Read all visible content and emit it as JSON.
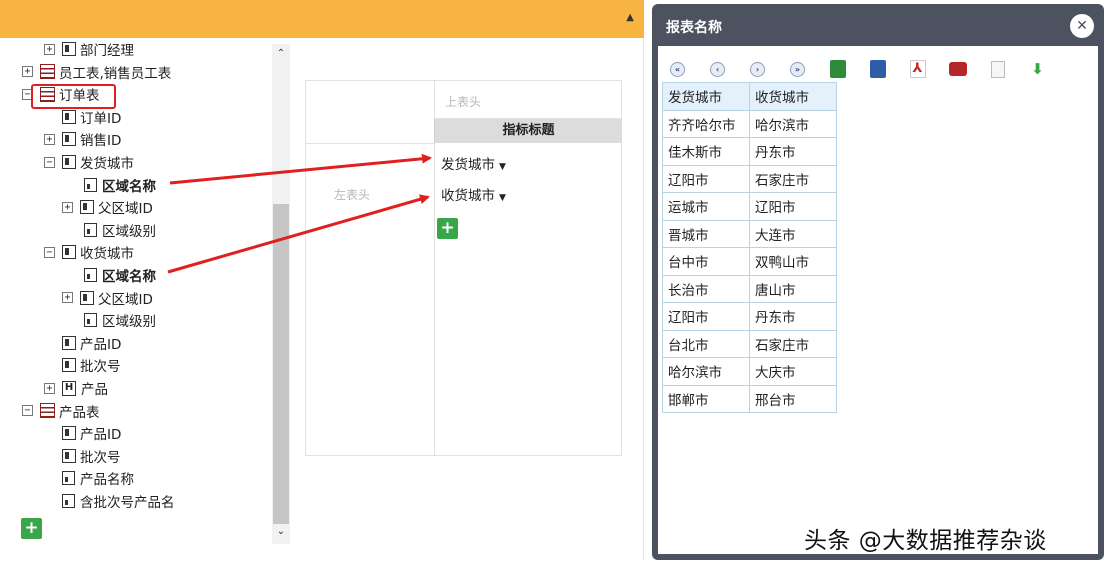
{
  "tree": {
    "items": [
      {
        "label": "部门经理",
        "indent": 1,
        "expander": "+",
        "icon": "field"
      },
      {
        "label": "员工表,销售员工表",
        "indent": 0,
        "expander": "+",
        "icon": "table"
      },
      {
        "label": "订单表",
        "indent": 0,
        "expander": "−",
        "icon": "table"
      },
      {
        "label": "订单ID",
        "indent": 2,
        "expander": "",
        "icon": "field"
      },
      {
        "label": "销售ID",
        "indent": 1,
        "expander": "+",
        "icon": "field"
      },
      {
        "label": "发货城市",
        "indent": 1,
        "expander": "−",
        "icon": "field"
      },
      {
        "label": "区域名称",
        "indent": 3,
        "expander": "",
        "icon": "leaf",
        "bold": true
      },
      {
        "label": "父区域ID",
        "indent": 2,
        "expander": "+",
        "icon": "field"
      },
      {
        "label": "区域级别",
        "indent": 3,
        "expander": "",
        "icon": "leaf"
      },
      {
        "label": "收货城市",
        "indent": 1,
        "expander": "−",
        "icon": "field"
      },
      {
        "label": "区域名称",
        "indent": 3,
        "expander": "",
        "icon": "leaf",
        "bold": true
      },
      {
        "label": "父区域ID",
        "indent": 2,
        "expander": "+",
        "icon": "field"
      },
      {
        "label": "区域级别",
        "indent": 3,
        "expander": "",
        "icon": "leaf"
      },
      {
        "label": "产品ID",
        "indent": 2,
        "expander": "",
        "icon": "field"
      },
      {
        "label": "批次号",
        "indent": 2,
        "expander": "",
        "icon": "field"
      },
      {
        "label": "产品",
        "indent": 1,
        "expander": "+",
        "icon": "H"
      },
      {
        "label": "产品表",
        "indent": 0,
        "expander": "−",
        "icon": "table"
      },
      {
        "label": "产品ID",
        "indent": 2,
        "expander": "",
        "icon": "field"
      },
      {
        "label": "批次号",
        "indent": 2,
        "expander": "",
        "icon": "field"
      },
      {
        "label": "产品名称",
        "indent": 2,
        "expander": "",
        "icon": "leaf"
      },
      {
        "label": "含批次号产品名",
        "indent": 2,
        "expander": "",
        "icon": "leaf"
      }
    ]
  },
  "designer": {
    "top_header": "上表头",
    "left_header": "左表头",
    "indicator_title": "指标标题",
    "fields": [
      "发货城市",
      "收货城市"
    ],
    "add_label": "+"
  },
  "tree_add_label": "+",
  "dialog": {
    "title": "报表名称",
    "close_label": "✕",
    "columns": [
      "发货城市",
      "收货城市"
    ],
    "rows": [
      [
        "齐齐哈尔市",
        "哈尔滨市"
      ],
      [
        "佳木斯市",
        "丹东市"
      ],
      [
        "辽阳市",
        "石家庄市"
      ],
      [
        "运城市",
        "辽阳市"
      ],
      [
        "晋城市",
        "大连市"
      ],
      [
        "台中市",
        "双鸭山市"
      ],
      [
        "长治市",
        "唐山市"
      ],
      [
        "辽阳市",
        "丹东市"
      ],
      [
        "台北市",
        "石家庄市"
      ],
      [
        "哈尔滨市",
        "大庆市"
      ],
      [
        "邯郸市",
        "邢台市"
      ]
    ]
  },
  "watermark": "头条 @大数据推荐杂谈",
  "colors": {
    "header_orange": "#f8b440",
    "add_green": "#3aa64a",
    "arrow_red": "#e02020",
    "dialog_frame": "#4d5260"
  }
}
